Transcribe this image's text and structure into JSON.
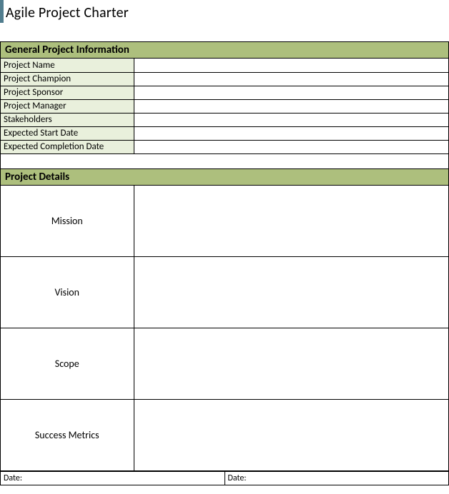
{
  "title": "Agile Project Charter",
  "sections": {
    "general": {
      "header": "General Project Information",
      "rows": [
        {
          "label": "Project Name",
          "value": ""
        },
        {
          "label": "Project Champion",
          "value": ""
        },
        {
          "label": "Project Sponsor",
          "value": ""
        },
        {
          "label": "Project Manager",
          "value": ""
        },
        {
          "label": "Stakeholders",
          "value": ""
        },
        {
          "label": "Expected Start Date",
          "value": ""
        },
        {
          "label": "Expected Completion Date",
          "value": ""
        }
      ]
    },
    "details": {
      "header": "Project Details",
      "rows": [
        {
          "label": "Mission",
          "value": ""
        },
        {
          "label": "Vision",
          "value": ""
        },
        {
          "label": "Scope",
          "value": ""
        },
        {
          "label": "Success Metrics",
          "value": ""
        }
      ]
    }
  },
  "footer": {
    "date1": {
      "label": "Date:",
      "value": ""
    },
    "date2": {
      "label": "Date:",
      "value": ""
    }
  }
}
